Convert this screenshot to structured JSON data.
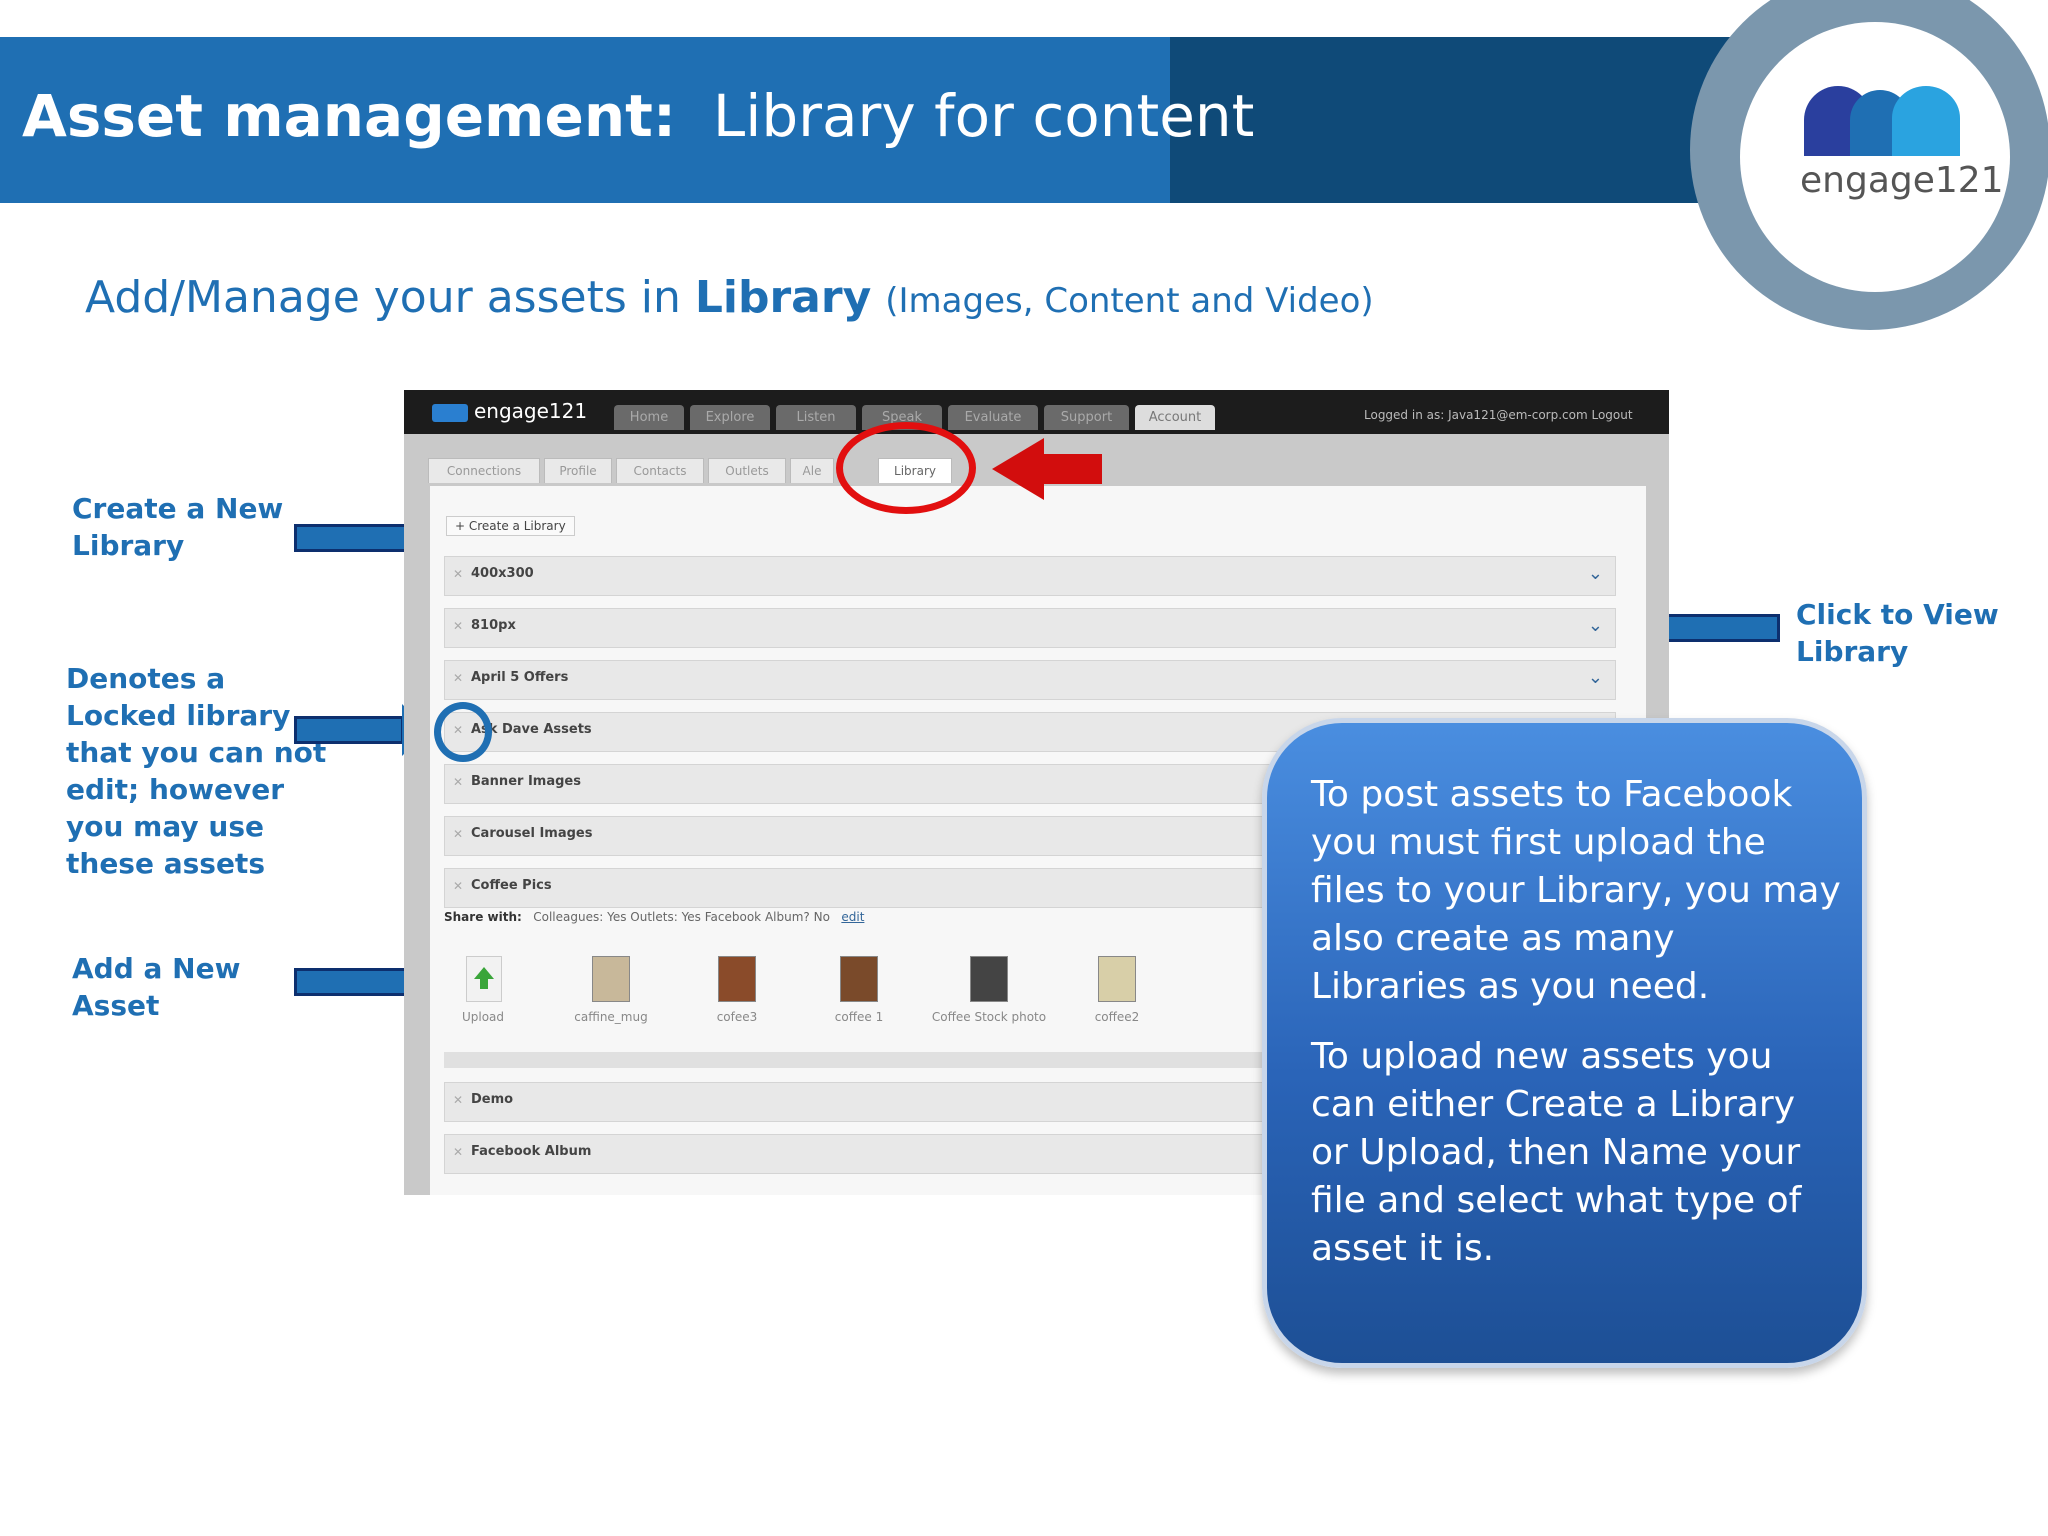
{
  "header": {
    "title_bold": "Asset management:",
    "title_rest": "Library for content",
    "logo_text": "engage121"
  },
  "subtitle": {
    "pre": "Add/Manage your assets in",
    "bold": "Library",
    "paren": "(Images, Content and Video)"
  },
  "annotations": {
    "create_library": [
      "Create a New",
      "Library"
    ],
    "locked_library": [
      "Denotes a",
      "Locked library",
      "that you can not",
      "edit; however",
      "you may use",
      "these assets"
    ],
    "add_asset": [
      "Add a New",
      "Asset"
    ],
    "view_library": [
      "Click to View",
      "Library"
    ]
  },
  "screenshot": {
    "logo": "engage121",
    "top_nav": [
      "Home",
      "Explore",
      "Listen",
      "Speak",
      "Evaluate",
      "Support",
      "Account"
    ],
    "active_top_nav": "Account",
    "login_text": "Logged in as: Java121@em-corp.com   Logout",
    "sub_tabs": [
      "Connections",
      "Profile",
      "Contacts",
      "Outlets",
      "Ale",
      "Library"
    ],
    "active_sub_tab": "Library",
    "create_button": "+ Create a Library",
    "libraries": [
      {
        "name": "400x300",
        "chevron": true
      },
      {
        "name": "810px",
        "chevron": true
      },
      {
        "name": "April 5 Offers",
        "chevron": true
      },
      {
        "name": "Ask Dave Assets",
        "chevron": false
      },
      {
        "name": "Banner Images",
        "chevron": false
      },
      {
        "name": "Carousel Images",
        "chevron": false
      },
      {
        "name": "Coffee Pics",
        "chevron": false
      }
    ],
    "share_with_label": "Share with:",
    "share_with": "Colleagues: Yes    Outlets: Yes    Facebook Album? No",
    "edit_link": "edit",
    "assets": [
      {
        "label": "Upload",
        "icon": "upload-icon"
      },
      {
        "label": "caffine_mug",
        "icon": "image-thumb"
      },
      {
        "label": "cofee3",
        "icon": "image-thumb"
      },
      {
        "label": "coffee 1",
        "icon": "image-thumb"
      },
      {
        "label": "Coffee Stock photo",
        "icon": "image-thumb"
      },
      {
        "label": "coffee2",
        "icon": "image-thumb"
      }
    ],
    "more_libraries": [
      "Demo",
      "Facebook Album"
    ]
  },
  "callout": {
    "paragraph1": "To post assets to Facebook you must first upload the files to your Library, you may also create as many Libraries as you need.",
    "paragraph2": "To upload new assets you can either Create a Library or Upload, then Name your file and select what type of asset it is."
  },
  "colors": {
    "brand_blue": "#1f6fb3",
    "header_dark": "#0f4a78",
    "highlight_red": "#e20f0f",
    "callout_blue": "#2a64b8"
  }
}
